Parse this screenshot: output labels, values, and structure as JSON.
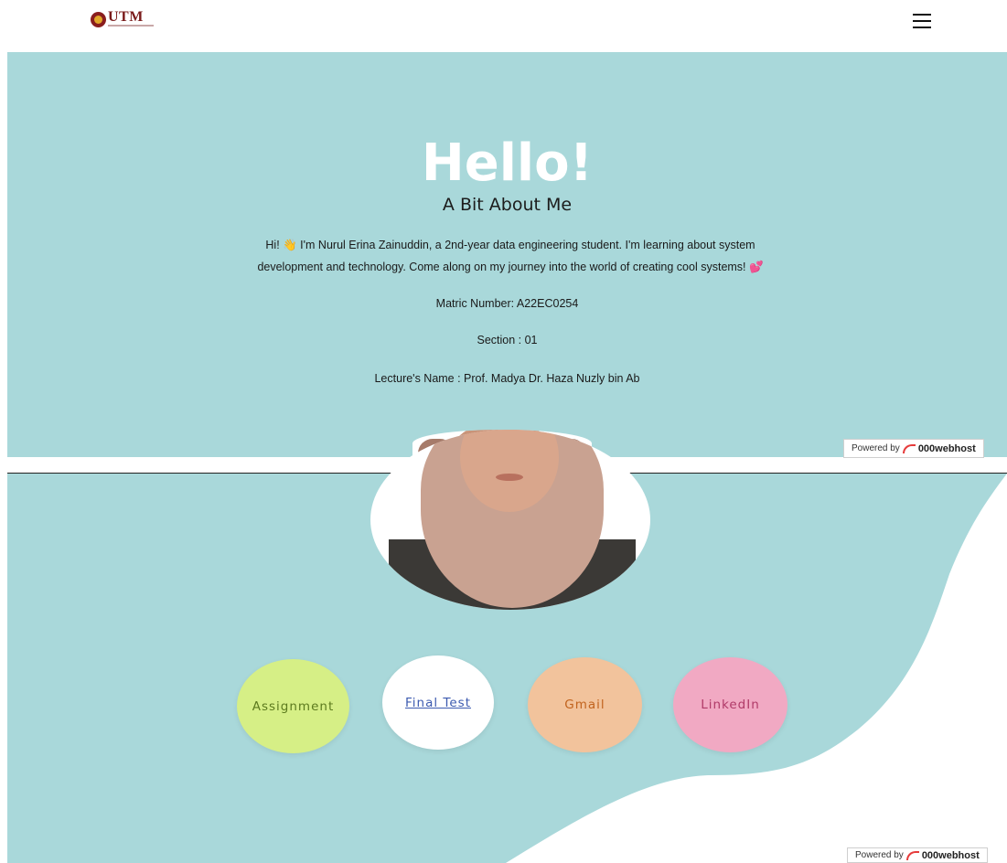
{
  "header": {
    "logo_text": "UTM",
    "menu_icon": "hamburger-menu-icon"
  },
  "hero": {
    "title": "Hello!",
    "subtitle": "A Bit About Me",
    "bio": "Hi! 👋 I'm Nurul Erina Zainuddin, a 2nd-year data engineering student. I'm learning about system development and technology. Come along on my journey into the world of creating cool systems! 💕",
    "matric": "Matric Number: A22EC0254",
    "section": "Section : 01",
    "lecturer": "Lecture's Name : Prof. Madya Dr. Haza Nuzly bin Ab"
  },
  "badge": {
    "powered_by": "Powered by",
    "host": "000webhost"
  },
  "links": {
    "assignment": "Assignment",
    "final_test": "Final Test",
    "gmail": "Gmail",
    "linkedin": "LinkedIn"
  },
  "colors": {
    "background_teal": "#a9d8da",
    "assignment": "#d6ef86",
    "final_test": "#ffffff",
    "gmail": "#f2c39c",
    "linkedin": "#f1a9c3"
  }
}
